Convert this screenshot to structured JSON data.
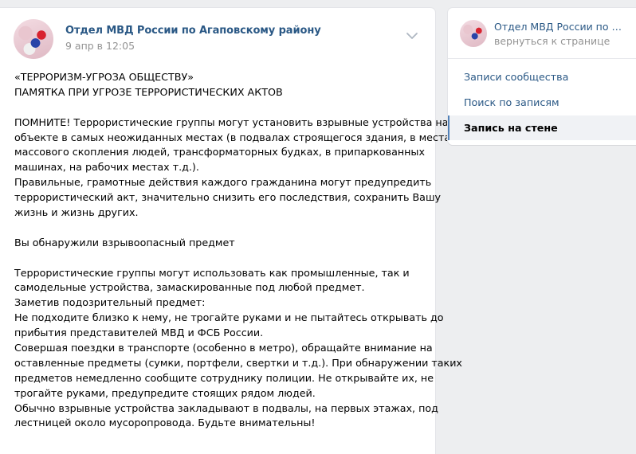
{
  "post": {
    "author": "Отдел МВД России по Агаповскому району",
    "date": "9 апр в 12:05",
    "lines": [
      "«ТЕРРОРИЗМ-УГРОЗА ОБЩЕСТВУ»",
      "ПАМЯТКА ПРИ УГРОЗЕ ТЕРРОРИСТИЧЕСКИХ АКТОВ",
      "",
      "ПОМНИТЕ! Террористические группы могут установить взрывные устройства на",
      "объекте в самых неожиданных местах (в подвалах строящегося здания, в местах",
      "массового скопления людей, трансформаторных будках, в припаркованных",
      "машинах, на рабочих местах т.д.).",
      "Правильные, грамотные действия каждого гражданина могут предупредить",
      "террористический акт, значительно снизить его последствия, сохранить Вашу",
      "жизнь и жизнь других.",
      "",
      "Вы обнаружили взрывоопасный предмет",
      "",
      "Террористические группы могут использовать как промышленные, так и",
      "самодельные устройства, замаскированные под любой предмет.",
      "Заметив подозрительный предмет:",
      "Не подходите близко к нему, не трогайте руками и не пытайтесь открывать до",
      "прибытия представителей МВД и ФСБ России.",
      "Совершая поездки в транспорте (особенно в метро), обращайте внимание на",
      "оставленные предметы (сумки, портфели, свертки и т.д.). При обнаружении таких",
      "предметов немедленно сообщите сотруднику полиции. Не открывайте их, не",
      "трогайте руками, предупредите стоящих рядом людей.",
      "Обычно взрывные устройства закладывают в подвалы, на первых этажах, под",
      "лестницей около мусоропровода. Будьте внимательны!"
    ]
  },
  "sidebar": {
    "group_name": "Отдел МВД России по Агаповскому району",
    "back_link": "вернуться к странице",
    "items": [
      {
        "label": "Записи сообщества",
        "active": false
      },
      {
        "label": "Поиск по записям",
        "active": false
      },
      {
        "label": "Запись на стене",
        "active": true
      }
    ]
  },
  "icons": {
    "post_menu": "chevron-down-icon"
  },
  "colors": {
    "link": "#2a5885",
    "accent": "#5181b8",
    "muted": "#939393",
    "background": "#edeef0"
  }
}
